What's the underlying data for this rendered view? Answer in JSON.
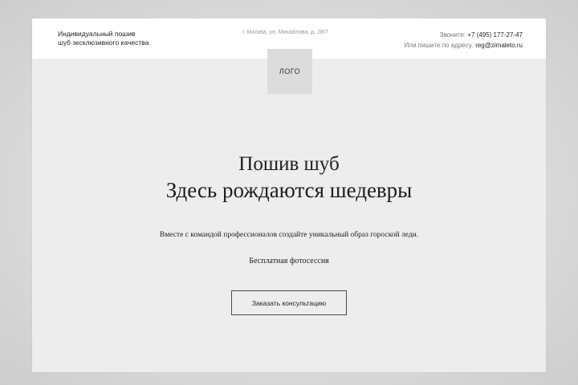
{
  "header": {
    "tagline": "Индивидуальный пошив\nшуб эксклюзивного качества",
    "address": "г. Москва, ул. Михайлова, д. 28/7",
    "phone_label": "Звоните: ",
    "phone": "+7 (495) 177-27-47",
    "email_label": "Или пишите по адресу: ",
    "email": "reg@zimaleto.ru"
  },
  "logo": {
    "label": "ЛОГО"
  },
  "hero": {
    "title_line1": "Пошив шуб",
    "title_line2": "Здесь рождаются шедевры",
    "description": "Вместе с командой профессионалов создайте уникальный образ гороской леди.",
    "note": "Бесплатная фотосессия",
    "cta_label": "Заказать консультацию"
  }
}
